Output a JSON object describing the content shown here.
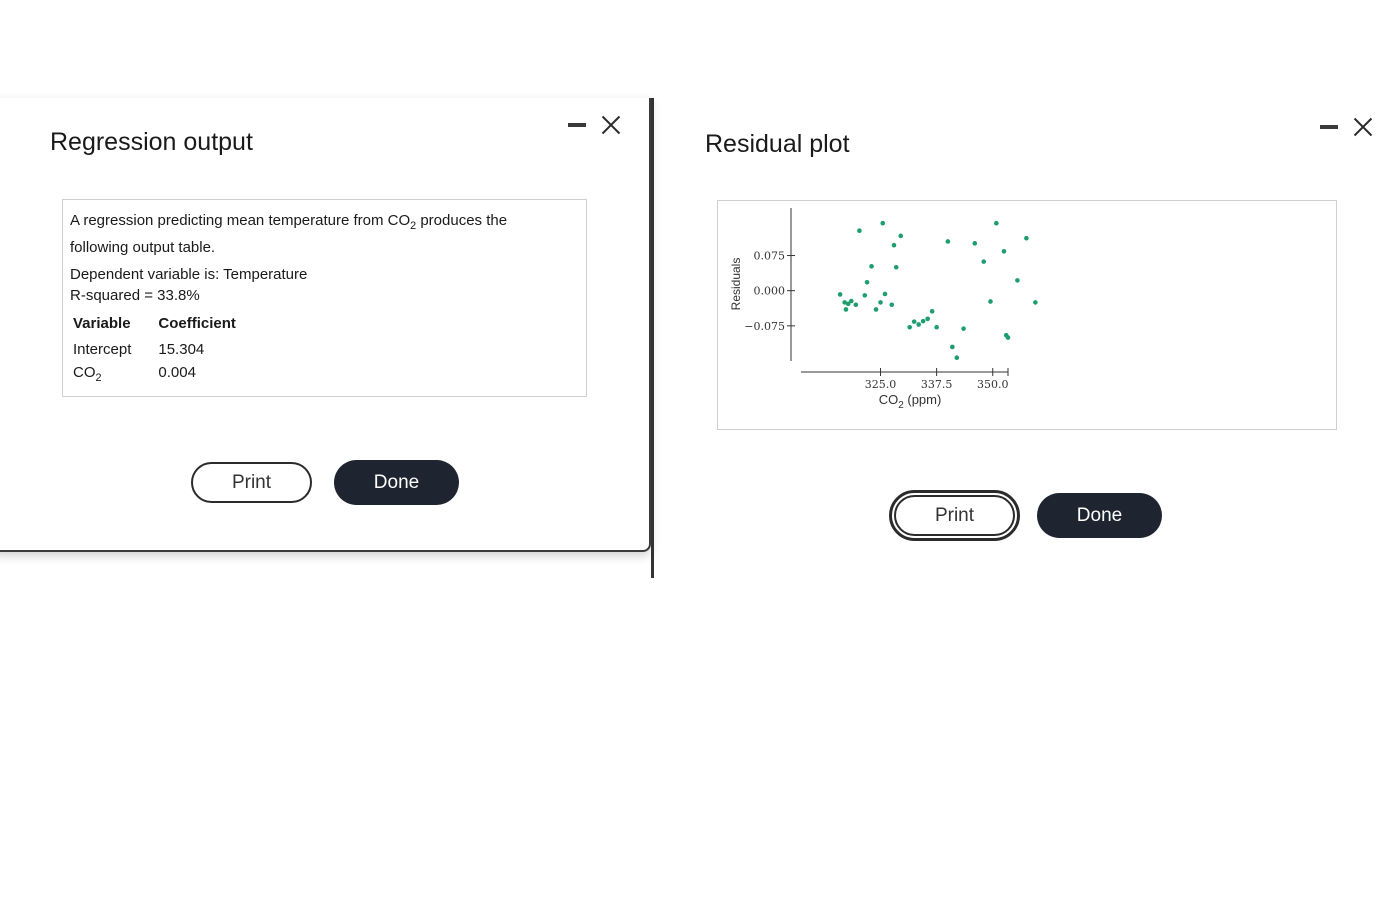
{
  "left_dialog": {
    "title": "Regression output",
    "intro_prefix": "A regression predicting mean temperature from CO",
    "intro_sub": "2",
    "intro_suffix": " produces the",
    "intro_line2": "following output table.",
    "dependent": "Dependent variable is: Temperature",
    "rsquared": "R-squared = 33.8%",
    "table": {
      "headers": [
        "Variable",
        "Coefficient"
      ],
      "rows": [
        {
          "variable": "Intercept",
          "variable_sub": "",
          "coefficient": "15.304"
        },
        {
          "variable": "CO",
          "variable_sub": "2",
          "coefficient": "0.004"
        }
      ]
    },
    "print_label": "Print",
    "done_label": "Done"
  },
  "right_dialog": {
    "title": "Residual plot",
    "print_label": "Print",
    "done_label": "Done"
  },
  "chart_data": {
    "type": "scatter",
    "title": "",
    "xlabel": "CO",
    "xlabel_sub": "2",
    "xlabel_suffix": " (ppm)",
    "ylabel": "Residuals",
    "xlim": [
      313.3,
      353.4
    ],
    "ylim": [
      -0.15,
      0.17
    ],
    "xticks": [
      325.0,
      337.5,
      350.0
    ],
    "xtick_labels": [
      "325.0",
      "337.5",
      "350.0"
    ],
    "yticks": [
      0.075,
      0.0,
      -0.075
    ],
    "ytick_labels": [
      "0.075",
      "0.000",
      "−0.075"
    ],
    "point_color": "#1e9e6e",
    "points": [
      {
        "x": 316.0,
        "y": -0.008
      },
      {
        "x": 317.0,
        "y": -0.025
      },
      {
        "x": 317.3,
        "y": -0.04
      },
      {
        "x": 317.8,
        "y": -0.028
      },
      {
        "x": 318.5,
        "y": -0.022
      },
      {
        "x": 319.5,
        "y": -0.03
      },
      {
        "x": 320.3,
        "y": 0.128
      },
      {
        "x": 321.5,
        "y": -0.01
      },
      {
        "x": 322.0,
        "y": 0.018
      },
      {
        "x": 323.0,
        "y": 0.052
      },
      {
        "x": 324.0,
        "y": -0.04
      },
      {
        "x": 325.0,
        "y": -0.025
      },
      {
        "x": 325.5,
        "y": 0.144
      },
      {
        "x": 326.0,
        "y": -0.007
      },
      {
        "x": 327.5,
        "y": -0.03
      },
      {
        "x": 328.0,
        "y": 0.097
      },
      {
        "x": 328.5,
        "y": 0.05
      },
      {
        "x": 329.5,
        "y": 0.117
      },
      {
        "x": 331.5,
        "y": -0.078
      },
      {
        "x": 332.5,
        "y": -0.066
      },
      {
        "x": 333.5,
        "y": -0.072
      },
      {
        "x": 334.5,
        "y": -0.065
      },
      {
        "x": 335.5,
        "y": -0.06
      },
      {
        "x": 336.5,
        "y": -0.044
      },
      {
        "x": 337.5,
        "y": -0.078
      },
      {
        "x": 340.0,
        "y": 0.105
      },
      {
        "x": 341.0,
        "y": -0.12
      },
      {
        "x": 342.0,
        "y": -0.143
      },
      {
        "x": 343.5,
        "y": -0.081
      },
      {
        "x": 346.0,
        "y": 0.101
      },
      {
        "x": 348.0,
        "y": 0.062
      },
      {
        "x": 349.5,
        "y": -0.023
      },
      {
        "x": 350.8,
        "y": 0.144
      },
      {
        "x": 352.5,
        "y": 0.084
      },
      {
        "x": 353.0,
        "y": -0.095
      },
      {
        "x": 353.4,
        "y": -0.1
      },
      {
        "x": 355.5,
        "y": 0.022
      },
      {
        "x": 357.5,
        "y": 0.112
      },
      {
        "x": 359.5,
        "y": -0.025
      }
    ]
  }
}
